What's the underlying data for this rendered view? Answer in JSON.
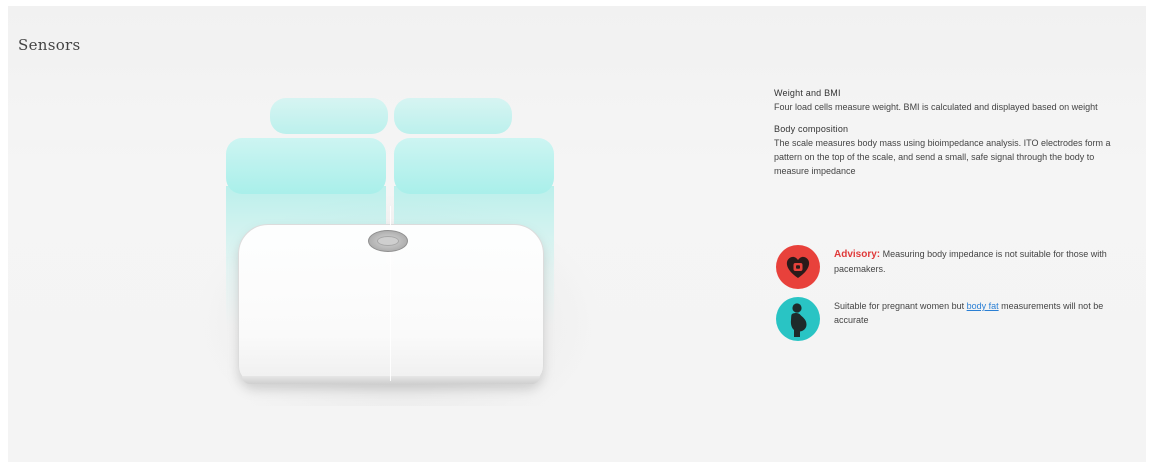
{
  "page": {
    "title": "Sensors"
  },
  "sections": {
    "weight": {
      "heading": "Weight and BMI",
      "body": "Four load cells measure weight. BMI is calculated and displayed based on weight"
    },
    "body_composition": {
      "heading": "Body composition",
      "body": "The scale measures body mass using bioimpedance analysis. ITO electrodes form a pattern on the top of the scale, and send a small, safe signal through the body to measure impedance"
    }
  },
  "notes": {
    "advisory": {
      "label": "Advisory:",
      "text": "Measuring body impedance is not suitable for those with pacemakers.",
      "icon": "heart-pacemaker-icon",
      "icon_color": "#e8413b"
    },
    "pregnancy": {
      "text_before": "Suitable for pregnant women but",
      "link_text": "body fat",
      "text_after": "measurements will not be accurate",
      "icon": "pregnant-woman-icon",
      "icon_color": "#29c4c4"
    }
  },
  "colors": {
    "accent_link": "#2a7fd4",
    "advisory_red": "#e03a3a",
    "sensor_cyan": "#a9efea"
  }
}
